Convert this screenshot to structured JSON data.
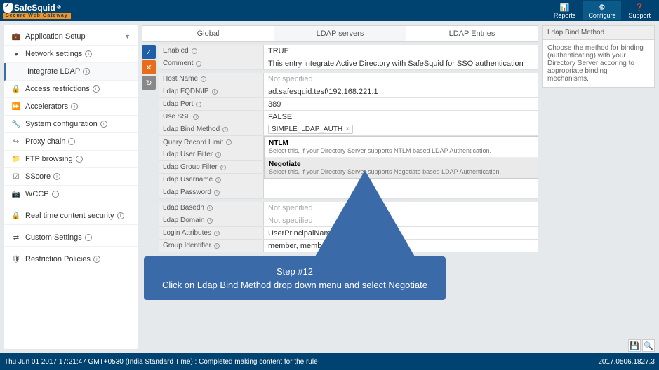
{
  "logo": {
    "name": "SafeSquid",
    "reg": "®",
    "tagline": "Secure Web Gateway"
  },
  "topnav": [
    {
      "icon": "📊",
      "label": "Reports"
    },
    {
      "icon": "⚙",
      "label": "Configure"
    },
    {
      "icon": "❓",
      "label": "Support"
    }
  ],
  "sidebar": [
    {
      "icon": "💼",
      "label": "Application Setup",
      "chev": true
    },
    {
      "icon": "●",
      "label": "Network settings",
      "info": true
    },
    {
      "icon": "│",
      "label": "Integrate LDAP",
      "info": true,
      "active": true
    },
    {
      "icon": "🔒",
      "label": "Access restrictions",
      "info": true
    },
    {
      "icon": "⏩",
      "label": "Accelerators",
      "info": true
    },
    {
      "icon": "🔧",
      "label": "System configuration",
      "info": true
    },
    {
      "icon": "↪",
      "label": "Proxy chain",
      "info": true
    },
    {
      "icon": "📁",
      "label": "FTP browsing",
      "info": true
    },
    {
      "icon": "☑",
      "label": "SScore",
      "info": true
    },
    {
      "icon": "📷",
      "label": "WCCP",
      "info": true
    },
    {
      "sep": true
    },
    {
      "icon": "🔒",
      "label": "Real time content security",
      "info": true
    },
    {
      "sep": true
    },
    {
      "icon": "⇄",
      "label": "Custom Settings",
      "info": true
    },
    {
      "sep": true
    },
    {
      "icon": "🛡",
      "label": "Restriction Policies",
      "info": true
    }
  ],
  "tabs": [
    {
      "label": "Global"
    },
    {
      "label": "LDAP servers",
      "active": true
    },
    {
      "label": "LDAP Entries"
    }
  ],
  "form": {
    "enabled": {
      "label": "Enabled",
      "value": "TRUE"
    },
    "comment": {
      "label": "Comment",
      "value": "This entry integrate Active Directory with SafeSquid for SSO authentication"
    },
    "host": {
      "label": "Host Name",
      "value": "Not specified",
      "muted": true
    },
    "fqdn": {
      "label": "Ldap FQDN\\IP",
      "value": "ad.safesquid.test\\192.168.221.1"
    },
    "port": {
      "label": "Ldap Port",
      "value": "389"
    },
    "ssl": {
      "label": "Use SSL",
      "value": "FALSE"
    },
    "bind": {
      "label": "Ldap Bind Method",
      "value": "SIMPLE_LDAP_AUTH"
    },
    "qrl": {
      "label": "Query Record Limit",
      "value": ""
    },
    "ufilter": {
      "label": "Ldap User Filter",
      "value": ""
    },
    "gfilter": {
      "label": "Ldap Group Filter",
      "value": ""
    },
    "uname": {
      "label": "Ldap Username",
      "value": ""
    },
    "pwd": {
      "label": "Ldap Password",
      "value": ""
    },
    "basedn": {
      "label": "Ldap Basedn",
      "value": "Not specified",
      "muted": true
    },
    "domain": {
      "label": "Ldap Domain",
      "value": "Not specified",
      "muted": true
    },
    "login": {
      "label": "Login Attributes",
      "value": "UserPrincipalName,  sAM                   ame,  uid"
    },
    "gid": {
      "label": "Group Identifier",
      "value": "member,  memberof"
    }
  },
  "dropdown": {
    "opt1": {
      "title": "NTLM",
      "desc": "Select this, if your Directory Server supports NTLM based LDAP Authentication."
    },
    "opt2": {
      "title": "Negotiate",
      "desc": "Select this, if your Directory Server supports Negotiate based LDAP Authentication."
    }
  },
  "rightpanel": {
    "header": "Ldap Bind Method",
    "body": "Choose the method for binding (authenticating) with your Directory Server accoring to appropriate binding mechanisms."
  },
  "callout": {
    "title": "Step #12",
    "body": "Click on Ldap Bind Method drop down menu and select Negotiate"
  },
  "footer": {
    "status": "Thu Jun 01 2017 17:21:47 GMT+0530 (India Standard Time) : Completed making content for the rule",
    "version": "2017.0506.1827.3"
  }
}
